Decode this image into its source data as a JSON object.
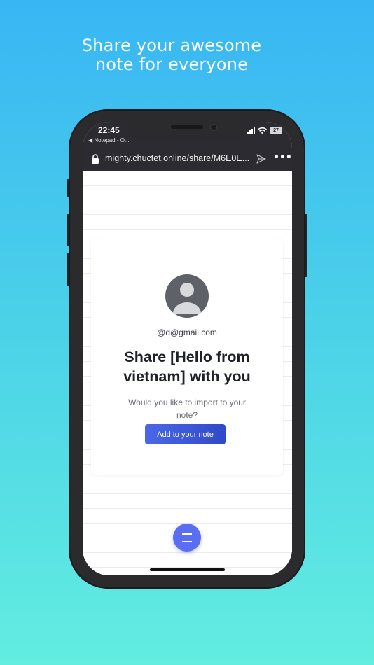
{
  "headline": {
    "line1": "Share your awesome",
    "line2": "note for everyone"
  },
  "status_bar": {
    "time": "22:45",
    "back_app": "◀ Notepad - O...",
    "battery": "27"
  },
  "browser": {
    "url": "mighty.chuctet.online/share/M6E0E...",
    "more_label": "•••"
  },
  "share_card": {
    "email": "@d@gmail.com",
    "title": "Share [Hello from vietnam] with you",
    "question": "Would you like to import to your note?",
    "button_label": "Add to your note"
  },
  "icons": [
    "lock-icon",
    "send-icon",
    "more-icon",
    "avatar-icon",
    "menu-icon",
    "signal-icon",
    "wifi-icon",
    "battery-icon"
  ],
  "colors": {
    "background_top": "#38b6f4",
    "background_bottom": "#62ede0",
    "button": "#3f5ad8",
    "fab": "#5b6df0"
  }
}
